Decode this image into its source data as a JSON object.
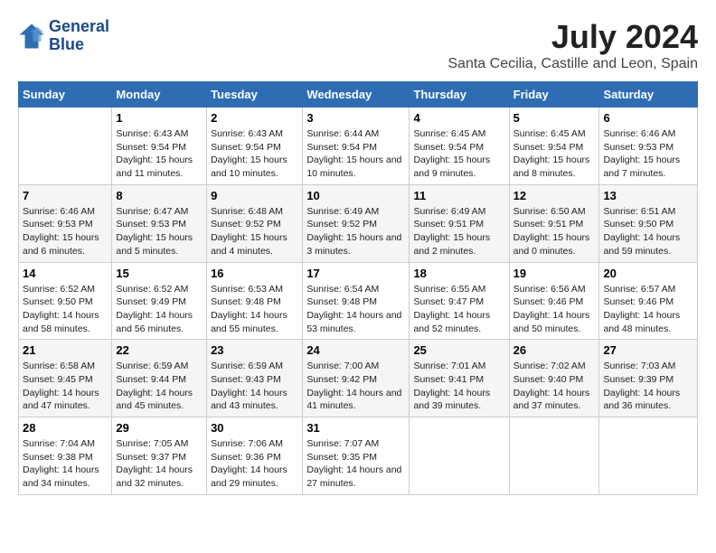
{
  "header": {
    "logo_line1": "General",
    "logo_line2": "Blue",
    "title": "July 2024",
    "subtitle": "Santa Cecilia, Castille and Leon, Spain"
  },
  "days_of_week": [
    "Sunday",
    "Monday",
    "Tuesday",
    "Wednesday",
    "Thursday",
    "Friday",
    "Saturday"
  ],
  "weeks": [
    [
      {
        "num": "",
        "sunrise": "",
        "sunset": "",
        "daylight": ""
      },
      {
        "num": "1",
        "sunrise": "Sunrise: 6:43 AM",
        "sunset": "Sunset: 9:54 PM",
        "daylight": "Daylight: 15 hours and 11 minutes."
      },
      {
        "num": "2",
        "sunrise": "Sunrise: 6:43 AM",
        "sunset": "Sunset: 9:54 PM",
        "daylight": "Daylight: 15 hours and 10 minutes."
      },
      {
        "num": "3",
        "sunrise": "Sunrise: 6:44 AM",
        "sunset": "Sunset: 9:54 PM",
        "daylight": "Daylight: 15 hours and 10 minutes."
      },
      {
        "num": "4",
        "sunrise": "Sunrise: 6:45 AM",
        "sunset": "Sunset: 9:54 PM",
        "daylight": "Daylight: 15 hours and 9 minutes."
      },
      {
        "num": "5",
        "sunrise": "Sunrise: 6:45 AM",
        "sunset": "Sunset: 9:54 PM",
        "daylight": "Daylight: 15 hours and 8 minutes."
      },
      {
        "num": "6",
        "sunrise": "Sunrise: 6:46 AM",
        "sunset": "Sunset: 9:53 PM",
        "daylight": "Daylight: 15 hours and 7 minutes."
      }
    ],
    [
      {
        "num": "7",
        "sunrise": "Sunrise: 6:46 AM",
        "sunset": "Sunset: 9:53 PM",
        "daylight": "Daylight: 15 hours and 6 minutes."
      },
      {
        "num": "8",
        "sunrise": "Sunrise: 6:47 AM",
        "sunset": "Sunset: 9:53 PM",
        "daylight": "Daylight: 15 hours and 5 minutes."
      },
      {
        "num": "9",
        "sunrise": "Sunrise: 6:48 AM",
        "sunset": "Sunset: 9:52 PM",
        "daylight": "Daylight: 15 hours and 4 minutes."
      },
      {
        "num": "10",
        "sunrise": "Sunrise: 6:49 AM",
        "sunset": "Sunset: 9:52 PM",
        "daylight": "Daylight: 15 hours and 3 minutes."
      },
      {
        "num": "11",
        "sunrise": "Sunrise: 6:49 AM",
        "sunset": "Sunset: 9:51 PM",
        "daylight": "Daylight: 15 hours and 2 minutes."
      },
      {
        "num": "12",
        "sunrise": "Sunrise: 6:50 AM",
        "sunset": "Sunset: 9:51 PM",
        "daylight": "Daylight: 15 hours and 0 minutes."
      },
      {
        "num": "13",
        "sunrise": "Sunrise: 6:51 AM",
        "sunset": "Sunset: 9:50 PM",
        "daylight": "Daylight: 14 hours and 59 minutes."
      }
    ],
    [
      {
        "num": "14",
        "sunrise": "Sunrise: 6:52 AM",
        "sunset": "Sunset: 9:50 PM",
        "daylight": "Daylight: 14 hours and 58 minutes."
      },
      {
        "num": "15",
        "sunrise": "Sunrise: 6:52 AM",
        "sunset": "Sunset: 9:49 PM",
        "daylight": "Daylight: 14 hours and 56 minutes."
      },
      {
        "num": "16",
        "sunrise": "Sunrise: 6:53 AM",
        "sunset": "Sunset: 9:48 PM",
        "daylight": "Daylight: 14 hours and 55 minutes."
      },
      {
        "num": "17",
        "sunrise": "Sunrise: 6:54 AM",
        "sunset": "Sunset: 9:48 PM",
        "daylight": "Daylight: 14 hours and 53 minutes."
      },
      {
        "num": "18",
        "sunrise": "Sunrise: 6:55 AM",
        "sunset": "Sunset: 9:47 PM",
        "daylight": "Daylight: 14 hours and 52 minutes."
      },
      {
        "num": "19",
        "sunrise": "Sunrise: 6:56 AM",
        "sunset": "Sunset: 9:46 PM",
        "daylight": "Daylight: 14 hours and 50 minutes."
      },
      {
        "num": "20",
        "sunrise": "Sunrise: 6:57 AM",
        "sunset": "Sunset: 9:46 PM",
        "daylight": "Daylight: 14 hours and 48 minutes."
      }
    ],
    [
      {
        "num": "21",
        "sunrise": "Sunrise: 6:58 AM",
        "sunset": "Sunset: 9:45 PM",
        "daylight": "Daylight: 14 hours and 47 minutes."
      },
      {
        "num": "22",
        "sunrise": "Sunrise: 6:59 AM",
        "sunset": "Sunset: 9:44 PM",
        "daylight": "Daylight: 14 hours and 45 minutes."
      },
      {
        "num": "23",
        "sunrise": "Sunrise: 6:59 AM",
        "sunset": "Sunset: 9:43 PM",
        "daylight": "Daylight: 14 hours and 43 minutes."
      },
      {
        "num": "24",
        "sunrise": "Sunrise: 7:00 AM",
        "sunset": "Sunset: 9:42 PM",
        "daylight": "Daylight: 14 hours and 41 minutes."
      },
      {
        "num": "25",
        "sunrise": "Sunrise: 7:01 AM",
        "sunset": "Sunset: 9:41 PM",
        "daylight": "Daylight: 14 hours and 39 minutes."
      },
      {
        "num": "26",
        "sunrise": "Sunrise: 7:02 AM",
        "sunset": "Sunset: 9:40 PM",
        "daylight": "Daylight: 14 hours and 37 minutes."
      },
      {
        "num": "27",
        "sunrise": "Sunrise: 7:03 AM",
        "sunset": "Sunset: 9:39 PM",
        "daylight": "Daylight: 14 hours and 36 minutes."
      }
    ],
    [
      {
        "num": "28",
        "sunrise": "Sunrise: 7:04 AM",
        "sunset": "Sunset: 9:38 PM",
        "daylight": "Daylight: 14 hours and 34 minutes."
      },
      {
        "num": "29",
        "sunrise": "Sunrise: 7:05 AM",
        "sunset": "Sunset: 9:37 PM",
        "daylight": "Daylight: 14 hours and 32 minutes."
      },
      {
        "num": "30",
        "sunrise": "Sunrise: 7:06 AM",
        "sunset": "Sunset: 9:36 PM",
        "daylight": "Daylight: 14 hours and 29 minutes."
      },
      {
        "num": "31",
        "sunrise": "Sunrise: 7:07 AM",
        "sunset": "Sunset: 9:35 PM",
        "daylight": "Daylight: 14 hours and 27 minutes."
      },
      {
        "num": "",
        "sunrise": "",
        "sunset": "",
        "daylight": ""
      },
      {
        "num": "",
        "sunrise": "",
        "sunset": "",
        "daylight": ""
      },
      {
        "num": "",
        "sunrise": "",
        "sunset": "",
        "daylight": ""
      }
    ]
  ]
}
